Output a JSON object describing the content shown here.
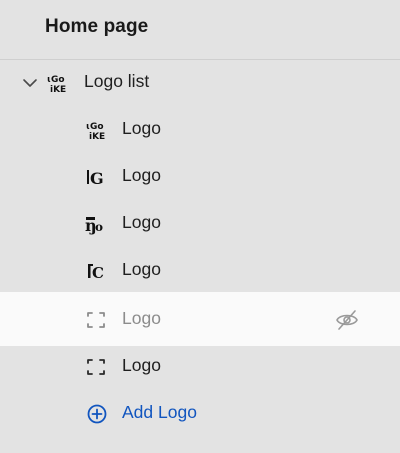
{
  "header": {
    "title": "Home page"
  },
  "tree": {
    "parent": {
      "label": "Logo list",
      "icon": "logo-thumbnail-icon",
      "expanded": true
    },
    "children": [
      {
        "label": "Logo",
        "icon": "logo-image-thumbnail-icon",
        "hidden": false
      },
      {
        "label": "Logo",
        "icon": "logo-image-thumbnail-icon",
        "hidden": false
      },
      {
        "label": "Logo",
        "icon": "logo-image-thumbnail-icon",
        "hidden": false
      },
      {
        "label": "Logo",
        "icon": "logo-image-thumbnail-icon",
        "hidden": false
      },
      {
        "label": "Logo",
        "icon": "image-placeholder-icon",
        "hidden": true
      },
      {
        "label": "Logo",
        "icon": "image-placeholder-icon",
        "hidden": false
      }
    ],
    "add": {
      "label": "Add Logo",
      "icon": "plus-circle-icon"
    }
  },
  "colors": {
    "background": "#e3e3e3",
    "hidden_row_background": "#fafafa",
    "link_blue": "#1155bf",
    "muted_text": "#8c8c8c"
  }
}
